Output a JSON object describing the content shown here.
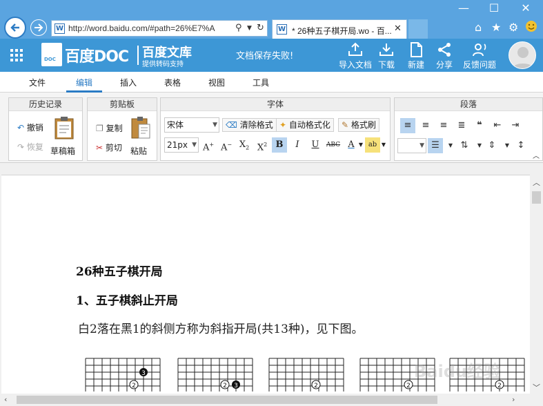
{
  "browser": {
    "address": "http://word.baidu.com/#path=26%E7%A",
    "tab_title": "* 26种五子棋开局.wo - 百...",
    "favicon_letter": "W",
    "window_controls": [
      "—",
      "☐",
      "✕"
    ],
    "toolbar_icons": [
      "home-icon",
      "star-icon",
      "gear-icon",
      "smiley-icon"
    ]
  },
  "app": {
    "brand": "百度DOC",
    "brand_doc": "DOC",
    "wenku": "百度文库",
    "wenku_sub": "提供转码支持",
    "save_status": "文档保存失败!",
    "actions": [
      {
        "label": "导入文档",
        "icon": "import-icon"
      },
      {
        "label": "下载",
        "icon": "download-icon"
      },
      {
        "label": "新建",
        "icon": "new-doc-icon"
      },
      {
        "label": "分享",
        "icon": "share-icon"
      },
      {
        "label": "反馈问题",
        "icon": "feedback-icon"
      }
    ]
  },
  "menu": {
    "tabs": [
      "文件",
      "编辑",
      "插入",
      "表格",
      "视图",
      "工具"
    ],
    "active": "编辑"
  },
  "ribbon": {
    "history": {
      "title": "历史记录",
      "undo": "撤销",
      "redo": "恢复",
      "draft": "草稿箱"
    },
    "clipboard": {
      "title": "剪贴板",
      "copy": "复制",
      "cut": "剪切",
      "paste": "粘贴"
    },
    "font": {
      "title": "字体",
      "family": "宋体",
      "size": "21px",
      "clear_format": "清除格式",
      "auto_format": "自动格式化",
      "format_painter": "格式刷"
    },
    "paragraph": {
      "title": "段落"
    }
  },
  "document": {
    "title": "26种五子棋开局",
    "heading1": "1、五子棋斜止开局",
    "para1": "白2落在黑1的斜侧方称为斜指开局(共13种)，见下图。",
    "board_marks": [
      "3",
      "2"
    ],
    "watermark": "Baidu经验"
  },
  "colors": {
    "chrome": "#5aa4e0",
    "appbar": "#3d97d6",
    "accent": "#2a7bc4"
  }
}
